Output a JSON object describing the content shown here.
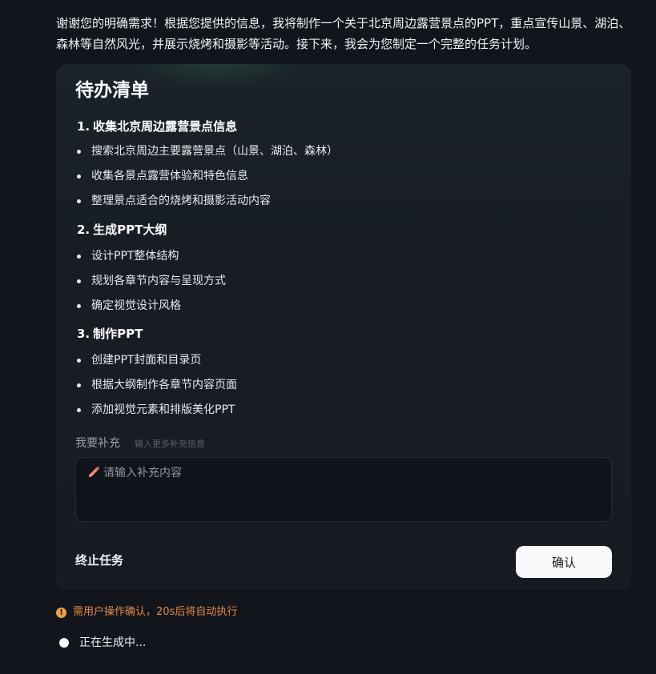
{
  "intro_text": "谢谢您的明确需求！根据您提供的信息，我将制作一个关于北京周边露营景点的PPT，重点宣传山景、湖泊、森林等自然风光，并展示烧烤和摄影等活动。接下来，我会为您制定一个完整的任务计划。",
  "todo": {
    "title": "待办清单",
    "sections": [
      {
        "number": "1.",
        "title": "收集北京周边露营景点信息",
        "items": [
          "搜索北京周边主要露营景点（山景、湖泊、森林）",
          "收集各景点露营体验和特色信息",
          "整理景点适合的烧烤和摄影活动内容"
        ]
      },
      {
        "number": "2.",
        "title": "生成PPT大纲",
        "items": [
          "设计PPT整体结构",
          "规划各章节内容与呈现方式",
          "确定视觉设计风格"
        ]
      },
      {
        "number": "3.",
        "title": "制作PPT",
        "items": [
          "创建PPT封面和目录页",
          "根据大纲制作各章节内容页面",
          "添加视觉元素和排版美化PPT"
        ]
      }
    ]
  },
  "supplement": {
    "label": "我要补充",
    "hint": "输入更多补充信息",
    "value": "",
    "placeholder": "请输入补充内容",
    "icon": "pencil-icon"
  },
  "actions": {
    "stop_label": "终止任务",
    "confirm_label": "确认"
  },
  "notice": {
    "icon": "warning-icon",
    "text": "需用户操作确认，20s后将自动执行",
    "color": "#e58a44"
  },
  "status": {
    "text": "正在生成中..."
  },
  "colors": {
    "background": "#12151b",
    "card": "#181c22",
    "input_bg": "#10131a",
    "button_bg": "#f8f9fa",
    "warning": "#f0a040"
  }
}
